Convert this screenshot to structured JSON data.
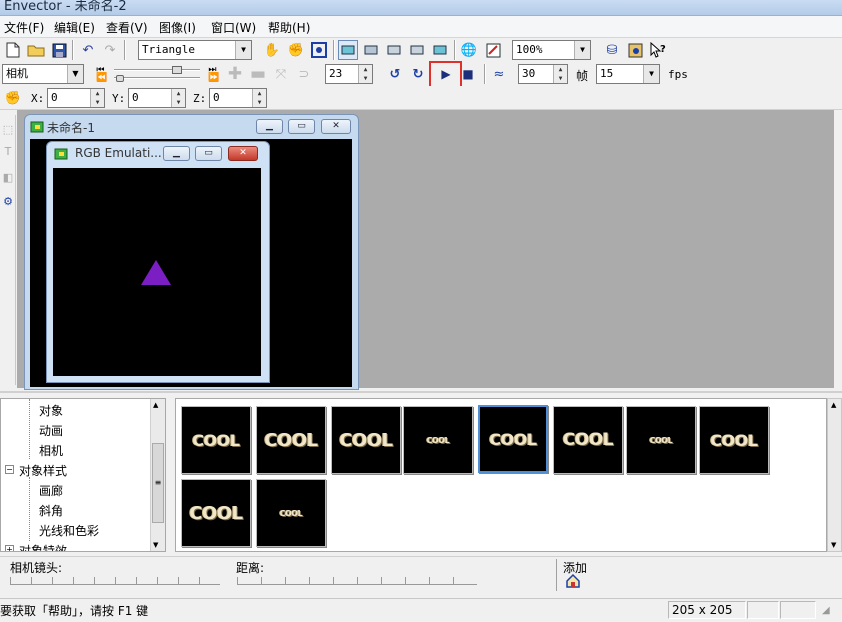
{
  "window": {
    "title": "Envector - 未命名-2"
  },
  "menu": [
    "文件(F)",
    "编辑(E)",
    "查看(V)",
    "图像(I)",
    "窗口(W)",
    "帮助(H)"
  ],
  "toolbar1": {
    "shape_select": "Triangle",
    "zoom_select": "100%"
  },
  "toolbar2": {
    "mode_select": "相机",
    "frame_value": "23",
    "fps_value": "30",
    "frame_label": "帧",
    "frames_select": "15",
    "fps_label": "fps"
  },
  "toolbar3": {
    "x_label": "X:",
    "x_value": "0",
    "y_label": "Y:",
    "y_value": "0",
    "z_label": "Z:",
    "z_value": "0"
  },
  "child_window": {
    "title": "未命名-1"
  },
  "emulation_window": {
    "title": "RGB Emulati...",
    "shape_color": "#7b1fc4"
  },
  "tree": {
    "items": [
      "对象",
      "动画",
      "相机",
      "对象样式",
      "画廊",
      "斜角",
      "光线和色彩",
      "对象特效"
    ]
  },
  "gallery": {
    "thumbs": [
      "COOL",
      "COOL",
      "COOL",
      "COOL",
      "COOL",
      "COOL",
      "COOL",
      "COOL",
      "COOL",
      "COOL"
    ]
  },
  "sliders": {
    "camera_label": "相机镜头:",
    "distance_label": "距离:",
    "add_label": "添加"
  },
  "status": {
    "help_text": "要获取「帮助」，请按 F1 键",
    "size_text": "205 x 205"
  },
  "colors": {
    "highlight_box": "#e0302a",
    "mdi_bg": "#ababab",
    "selected_thumb": "#4f8fd6"
  }
}
